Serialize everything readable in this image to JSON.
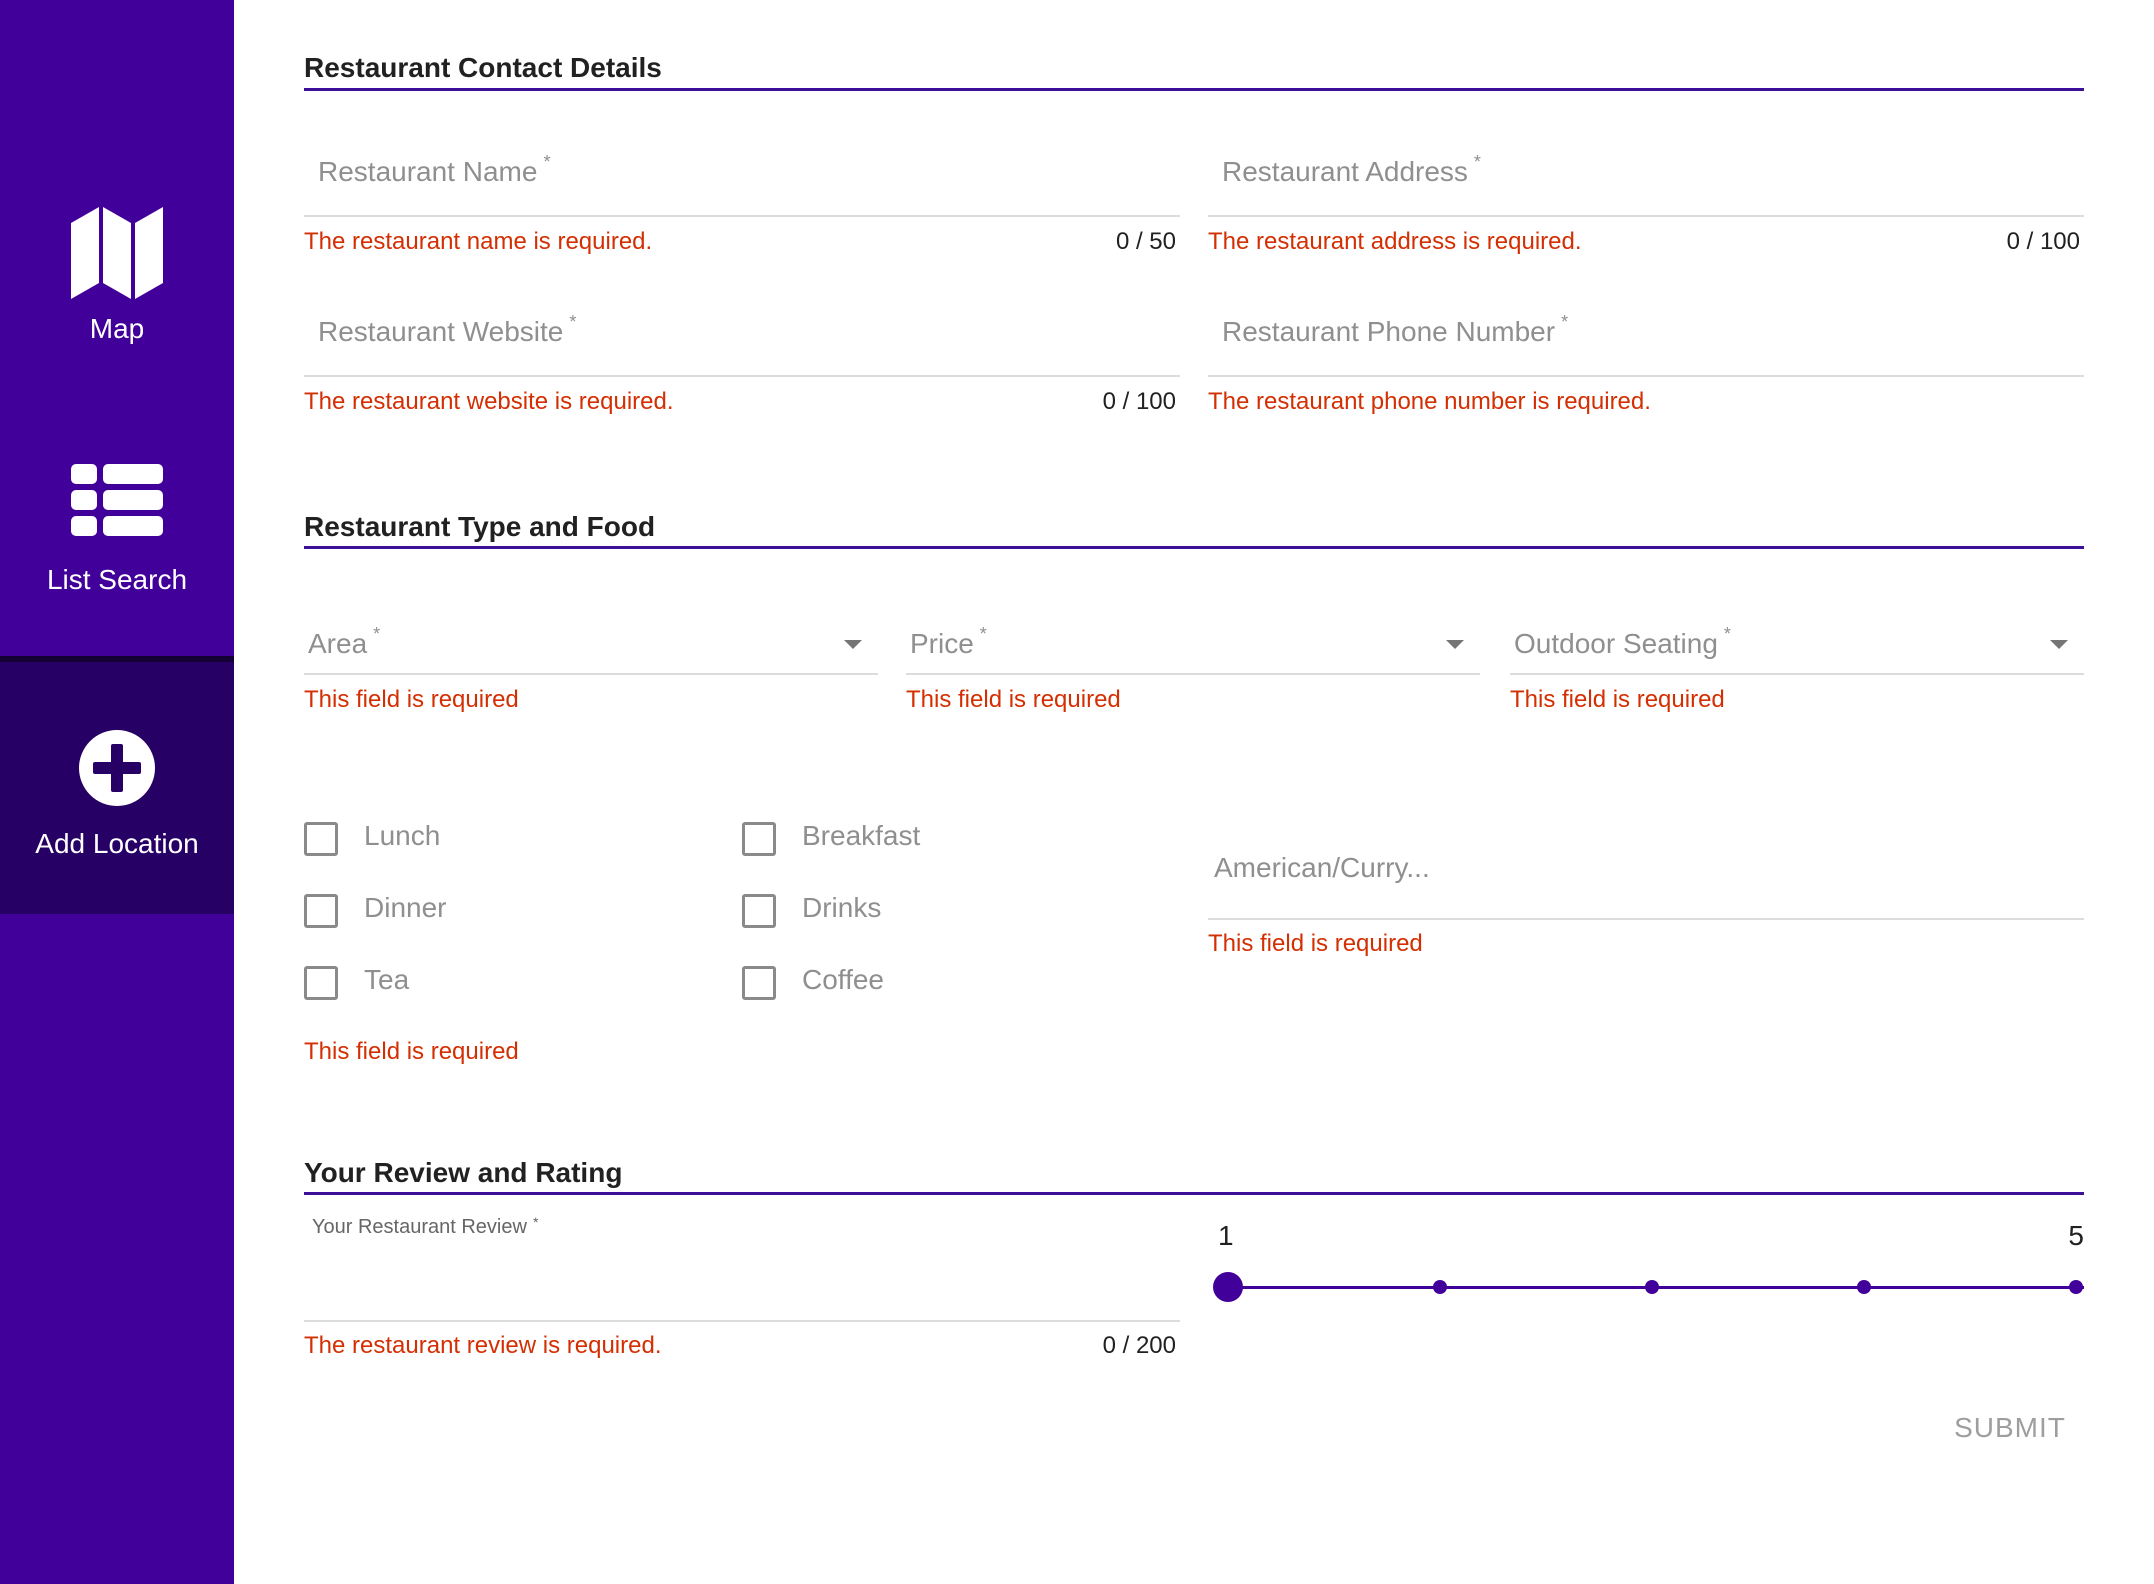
{
  "sidebar": {
    "items": [
      {
        "label": "Map",
        "icon": "map-icon"
      },
      {
        "label": "List Search",
        "icon": "list-icon"
      },
      {
        "label": "Add Location",
        "icon": "plus-circle-icon",
        "active": true
      }
    ],
    "colors": {
      "background": "#42009b",
      "active_background": "#270066"
    }
  },
  "sections": {
    "contact": {
      "title": "Restaurant Contact Details"
    },
    "type_food": {
      "title": "Restaurant Type and Food"
    },
    "review": {
      "title": "Your Review and Rating"
    }
  },
  "contact_fields": {
    "name": {
      "label": "Restaurant Name",
      "required_mark": "*",
      "error": "The restaurant name is required.",
      "counter": "0 / 50"
    },
    "address": {
      "label": "Restaurant Address",
      "required_mark": "*",
      "error": "The restaurant address is required.",
      "counter": "0 / 100"
    },
    "website": {
      "label": "Restaurant Website",
      "required_mark": "*",
      "error": "The restaurant website is required.",
      "counter": "0 / 100"
    },
    "phone": {
      "label": "Restaurant Phone Number",
      "required_mark": "*",
      "error": "The restaurant phone number is required."
    }
  },
  "selects": {
    "area": {
      "label": "Area",
      "required_mark": "*",
      "error": "This field is required"
    },
    "price": {
      "label": "Price",
      "required_mark": "*",
      "error": "This field is required"
    },
    "outdoor": {
      "label": "Outdoor Seating",
      "required_mark": "*",
      "error": "This field is required"
    }
  },
  "meals": {
    "options": [
      "Lunch",
      "Breakfast",
      "Dinner",
      "Drinks",
      "Tea",
      "Coffee"
    ],
    "error": "This field is required"
  },
  "cuisine": {
    "placeholder": "American/Curry...",
    "error": "This field is required"
  },
  "review": {
    "label": "Your Restaurant Review",
    "required_mark": "*",
    "error": "The restaurant review is required.",
    "counter": "0 / 200"
  },
  "rating": {
    "min_label": "1",
    "max_label": "5",
    "min": 1,
    "max": 5,
    "value": 1
  },
  "submit": {
    "label": "SUBMIT"
  },
  "colors": {
    "accent": "#42009b",
    "error": "#d32f02",
    "muted": "#8f8f8f"
  }
}
